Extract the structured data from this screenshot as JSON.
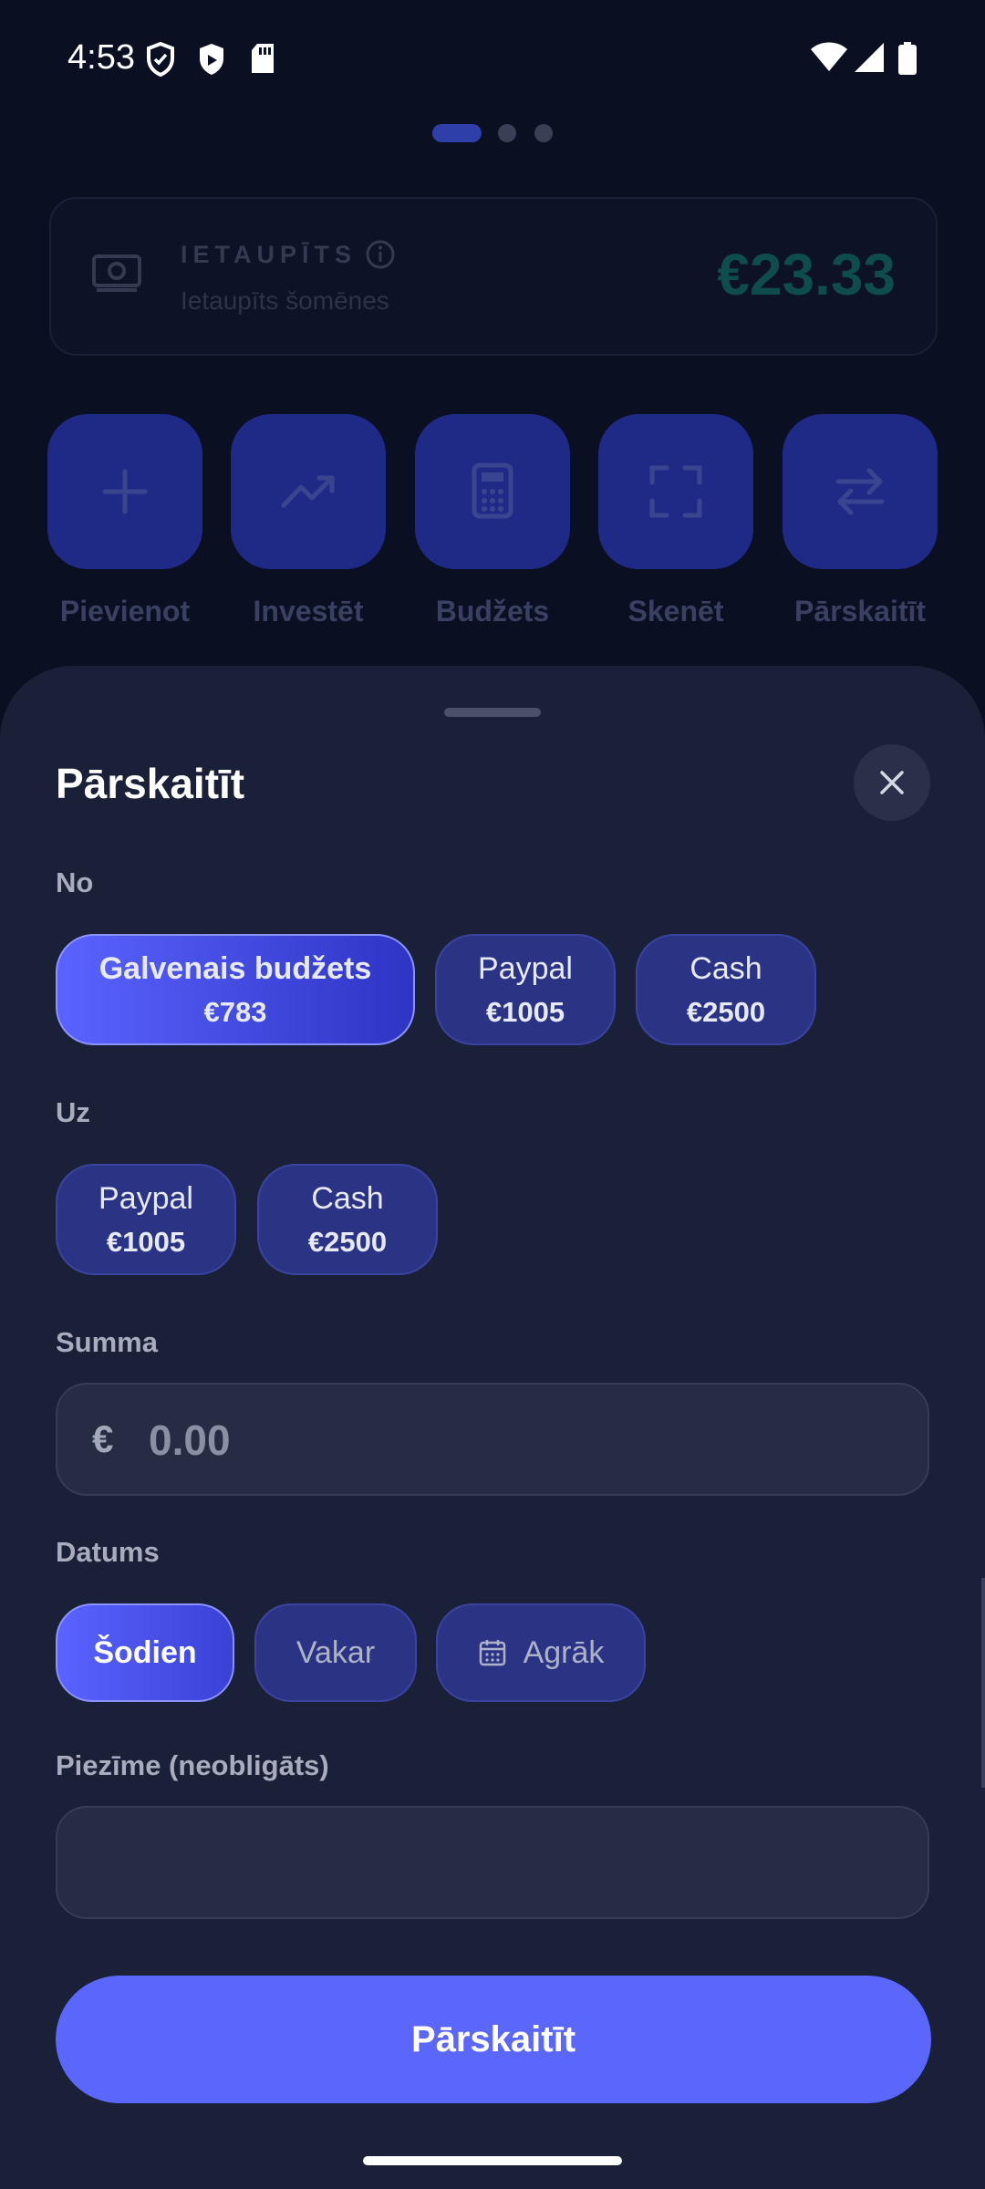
{
  "status_bar": {
    "time": "4:53",
    "left_icons": [
      "vpn-shield-icon",
      "shield-icon",
      "sd-card-icon"
    ],
    "right_icons": [
      "wifi-icon",
      "signal-icon",
      "battery-icon"
    ]
  },
  "pager": {
    "total": 3,
    "active": 0
  },
  "savings_card": {
    "title": "IETAUPĪTS",
    "subtitle": "Ietaupīts šomēnes",
    "amount": "€23.33",
    "icon": "money-icon",
    "info_icon": "info-icon"
  },
  "actions": [
    {
      "label": "Pievienot",
      "icon": "plus-icon"
    },
    {
      "label": "Investēt",
      "icon": "trending-up-icon"
    },
    {
      "label": "Budžets",
      "icon": "calculator-icon"
    },
    {
      "label": "Skenēt",
      "icon": "scan-icon"
    },
    {
      "label": "Pārskaitīt",
      "icon": "transfer-icon"
    }
  ],
  "sheet": {
    "title": "Pārskaitīt",
    "close_icon": "close-icon",
    "from_label": "No",
    "from_accounts": [
      {
        "name": "Galvenais budžets",
        "amount": "€783",
        "selected": true
      },
      {
        "name": "Paypal",
        "amount": "€1005",
        "selected": false
      },
      {
        "name": "Cash",
        "amount": "€2500",
        "selected": false
      }
    ],
    "to_label": "Uz",
    "to_accounts": [
      {
        "name": "Paypal",
        "amount": "€1005",
        "selected": false
      },
      {
        "name": "Cash",
        "amount": "€2500",
        "selected": false
      }
    ],
    "amount_label": "Summa",
    "currency_symbol": "€",
    "amount_placeholder": "0.00",
    "amount_value": "",
    "date_label": "Datums",
    "date_options": [
      {
        "label": "Šodien",
        "selected": true
      },
      {
        "label": "Vakar",
        "selected": false
      },
      {
        "label": "Agrāk",
        "selected": false,
        "icon": "calendar-icon"
      }
    ],
    "note_label": "Piezīme (neobligāts)",
    "note_value": "",
    "submit_label": "Pārskaitīt"
  },
  "colors": {
    "background": "#0b0f22",
    "sheet": "#1a2037",
    "accent": "#5b67fb",
    "chip": "#2b3484",
    "savings_amount": "#0e4c4e"
  }
}
